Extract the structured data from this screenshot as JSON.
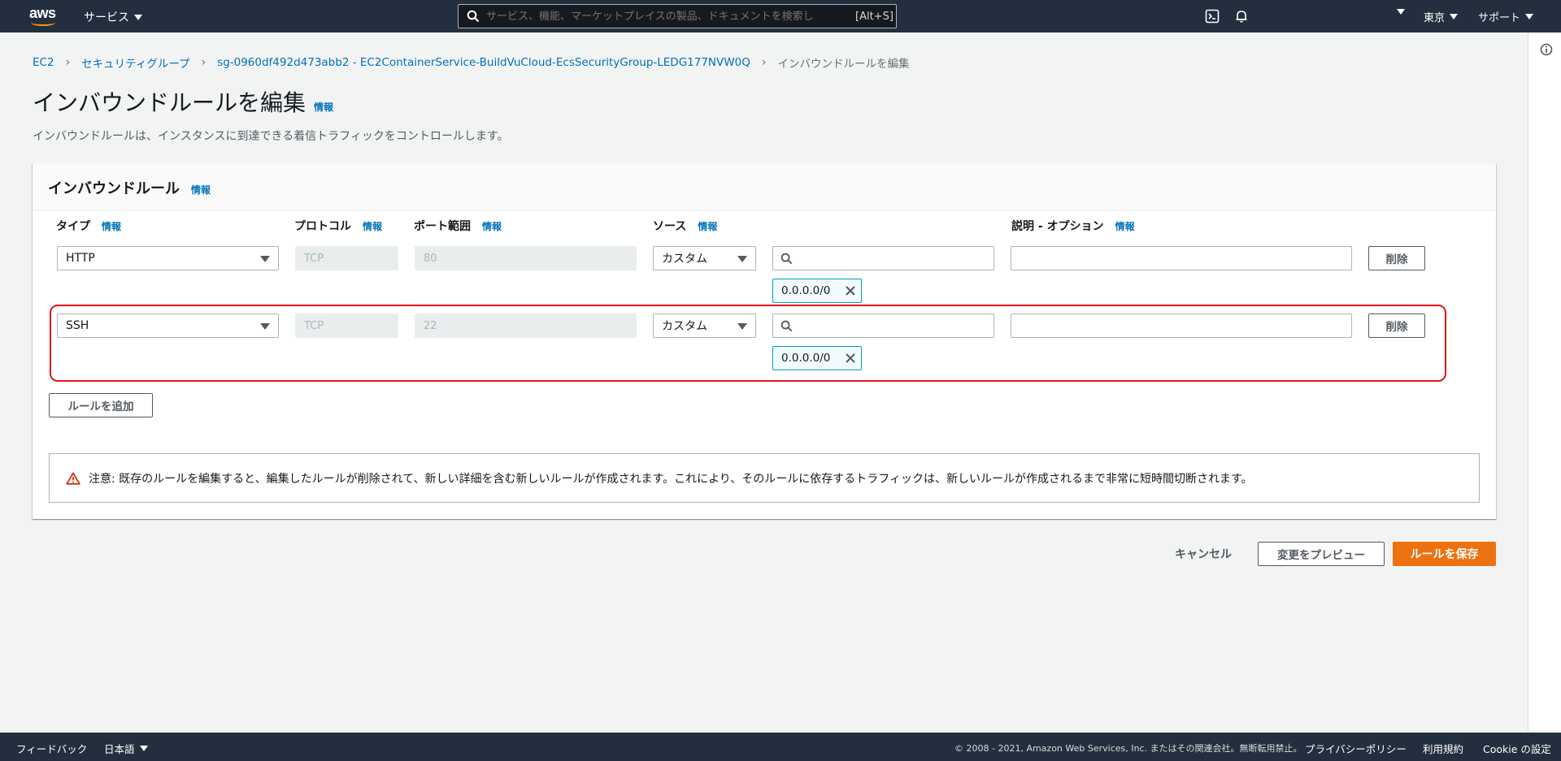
{
  "topnav": {
    "logo_text": "aws",
    "services_label": "サービス",
    "search_placeholder": "サービス、機能、マーケットプレイスの製品、ドキュメントを検索し",
    "search_shortcut": "[Alt+S]",
    "region_label": "東京",
    "support_label": "サポート"
  },
  "breadcrumb": {
    "items": [
      "EC2",
      "セキュリティグループ",
      "sg-0960df492d473abb2 - EC2ContainerService-BuildVuCloud-EcsSecurityGroup-LEDG177NVW0Q"
    ],
    "current": "インバウンドルールを編集"
  },
  "page": {
    "title": "インバウンドルールを編集",
    "info": "情報",
    "description": "インバウンドルールは、インスタンスに到達できる着信トラフィックをコントロールします。"
  },
  "panel": {
    "title": "インバウンドルール",
    "info": "情報",
    "columns": {
      "type": "タイプ",
      "protocol": "プロトコル",
      "port_range": "ポート範囲",
      "source": "ソース",
      "description": "説明 - オプション"
    },
    "rules": [
      {
        "type": "HTTP",
        "protocol": "TCP",
        "port": "80",
        "source_type": "カスタム",
        "source_search": "",
        "cidr": "0.0.0.0/0",
        "description": "",
        "delete_label": "削除"
      },
      {
        "type": "SSH",
        "protocol": "TCP",
        "port": "22",
        "source_type": "カスタム",
        "source_search": "",
        "cidr": "0.0.0.0/0",
        "description": "",
        "delete_label": "削除"
      }
    ],
    "add_rule_label": "ルールを追加",
    "alert_text": "注意: 既存のルールを編集すると、編集したルールが削除されて、新しい詳細を含む新しいルールが作成されます。これにより、そのルールに依存するトラフィックは、新しいルールが作成されるまで非常に短時間切断されます。"
  },
  "actions": {
    "cancel": "キャンセル",
    "preview": "変更をプレビュー",
    "save": "ルールを保存"
  },
  "footer": {
    "feedback": "フィードバック",
    "language": "日本語",
    "copyright": "© 2008 - 2021, Amazon Web Services, Inc. またはその関連会社。無断転用禁止。",
    "privacy": "プライバシーポリシー",
    "terms": "利用規約",
    "cookie": "Cookie の設定"
  },
  "colors": {
    "nav_bg": "#232f3e",
    "link": "#0073bb",
    "primary": "#ec7211",
    "highlight": "#e0151b",
    "token_border": "#00a1c9"
  }
}
